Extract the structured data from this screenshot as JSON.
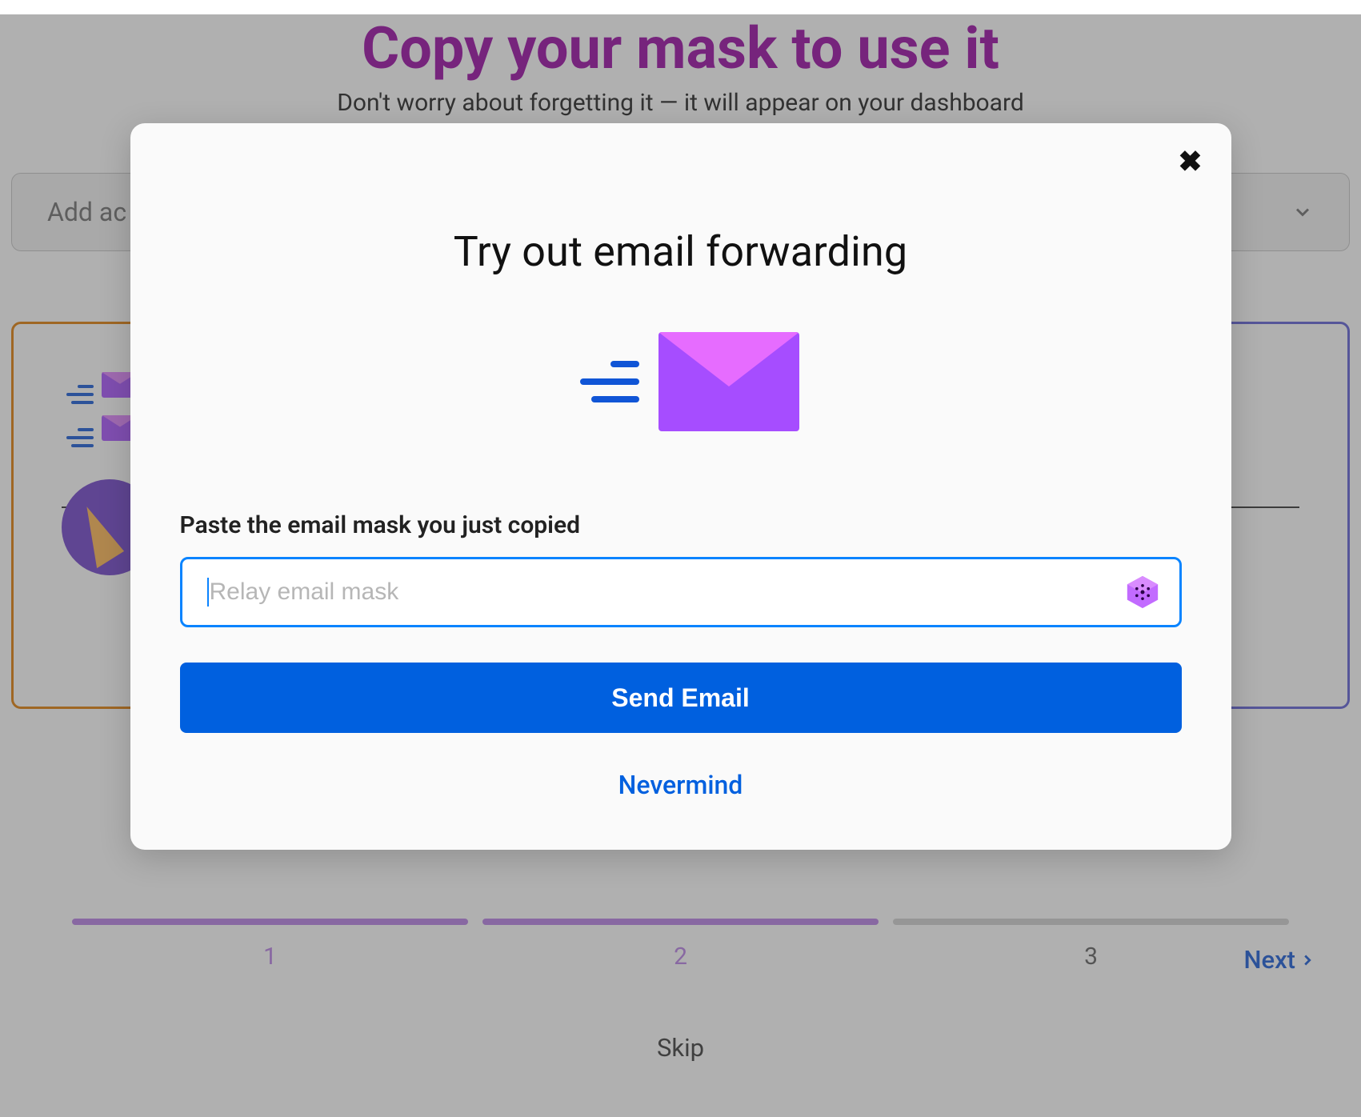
{
  "background": {
    "title": "Copy your mask to use it",
    "subtitle": "Don't worry about forgetting it — it will appear on your dashboard",
    "dropdown_label": "Add ac",
    "progress": {
      "steps": [
        {
          "label": "1",
          "active": true
        },
        {
          "label": "2",
          "active": true
        },
        {
          "label": "3",
          "active": false
        }
      ]
    },
    "next_label": "Next",
    "skip_label": "Skip"
  },
  "modal": {
    "title": "Try out email forwarding",
    "field_label": "Paste the email mask you just copied",
    "input_placeholder": "Relay email mask",
    "input_value": "",
    "primary_button": "Send Email",
    "secondary_link": "Nevermind"
  }
}
